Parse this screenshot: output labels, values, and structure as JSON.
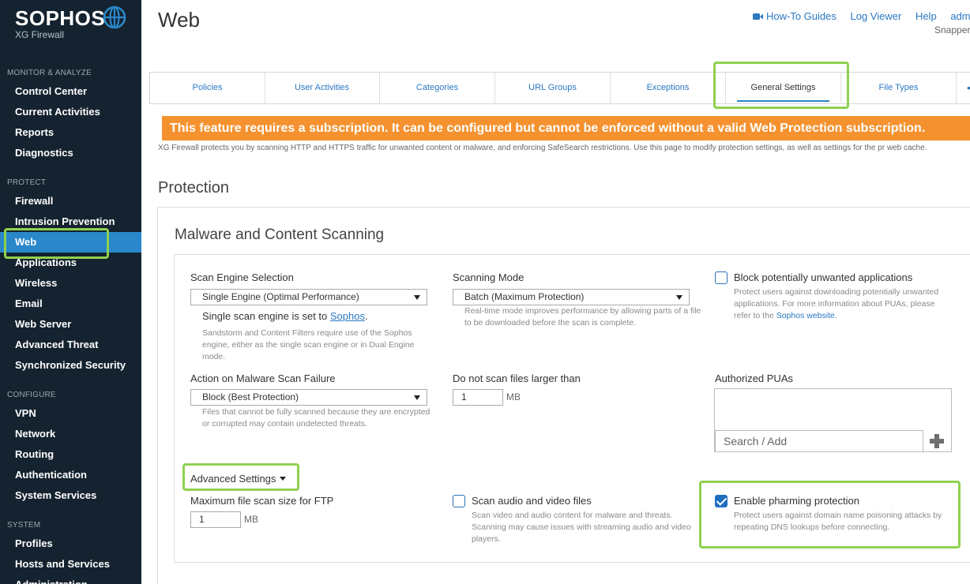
{
  "sidebar": {
    "brand": "SOPHOS",
    "product": "XG Firewall",
    "sections": {
      "monitor": "MONITOR & ANALYZE",
      "protect": "PROTECT",
      "configure": "CONFIGURE",
      "system": "SYSTEM"
    },
    "items": {
      "control_center": "Control Center",
      "current_activities": "Current Activities",
      "reports": "Reports",
      "diagnostics": "Diagnostics",
      "firewall": "Firewall",
      "intrusion_prevention": "Intrusion Prevention",
      "web": "Web",
      "applications": "Applications",
      "wireless": "Wireless",
      "email": "Email",
      "web_server": "Web Server",
      "advanced_threat": "Advanced Threat",
      "synchronized_security": "Synchronized Security",
      "vpn": "VPN",
      "network": "Network",
      "routing": "Routing",
      "authentication": "Authentication",
      "system_services": "System Services",
      "profiles": "Profiles",
      "hosts_and_services": "Hosts and Services",
      "administration": "Administration"
    },
    "active_item": "Web",
    "colors": {
      "background": "#14232f",
      "active": "#2a87c9"
    }
  },
  "header": {
    "title": "Web",
    "links": {
      "howto": "How-To Guides",
      "log_viewer": "Log Viewer",
      "help": "Help",
      "admin": "adm"
    },
    "user": "Snapper"
  },
  "tabs": [
    "Policies",
    "User Activities",
    "Categories",
    "URL Groups",
    "Exceptions",
    "General Settings",
    "File Types"
  ],
  "active_tab": "General Settings",
  "banner": {
    "text": "This feature requires a subscription. It can be configured but cannot be enforced without a valid Web Protection subscription.",
    "color": "#f5922f"
  },
  "intro": "XG Firewall protects you by scanning HTTP and HTTPS traffic for unwanted content or malware, and enforcing SafeSearch restrictions. Use this page to modify protection settings, as well as settings for the pr web cache.",
  "protection": {
    "title": "Protection",
    "malware": {
      "title": "Malware and Content Scanning",
      "scan_engine": {
        "label": "Scan Engine Selection",
        "value": "Single Engine (Optimal Performance)",
        "note_prefix": "Single scan engine is set to ",
        "note_link": "Sophos",
        "note_suffix": ".",
        "help": "Sandstorm and Content Filters require use of the Sophos engine, either as the single scan engine or in Dual Engine mode."
      },
      "scanning_mode": {
        "label": "Scanning Mode",
        "value": "Batch (Maximum Protection)",
        "help": "Real-time mode improves performance by allowing parts of a file to be downloaded before the scan is complete."
      },
      "block_pua": {
        "label": "Block potentially unwanted applications",
        "checked": false,
        "help_text": "Protect users against downloading potentially unwanted applications. For more information about PUAs, please refer to the ",
        "help_link": "Sophos website",
        "help_suffix": "."
      },
      "scan_failure": {
        "label": "Action on Malware Scan Failure",
        "value": "Block (Best Protection)",
        "help": "Files that cannot be fully scanned because they are encrypted or corrupted may contain undetected threats."
      },
      "max_size": {
        "label": "Do not scan files larger than",
        "value": "1",
        "unit": "MB"
      },
      "authorized_puas": {
        "label": "Authorized PUAs",
        "placeholder": "Search / Add"
      },
      "advanced": {
        "label": "Advanced Settings",
        "ftp": {
          "label": "Maximum file scan size for FTP",
          "value": "1",
          "unit": "MB"
        },
        "audio_video": {
          "label": "Scan audio and video files",
          "checked": false,
          "help": "Scan video and audio content for malware and threats. Scanning may cause issues with streaming audio and video players."
        },
        "pharming": {
          "label": "Enable pharming protection",
          "checked": true,
          "help": "Protect users against domain name poisoning attacks by repeating DNS lookups before connecting."
        }
      }
    }
  },
  "highlight_color": "#8fd14f"
}
